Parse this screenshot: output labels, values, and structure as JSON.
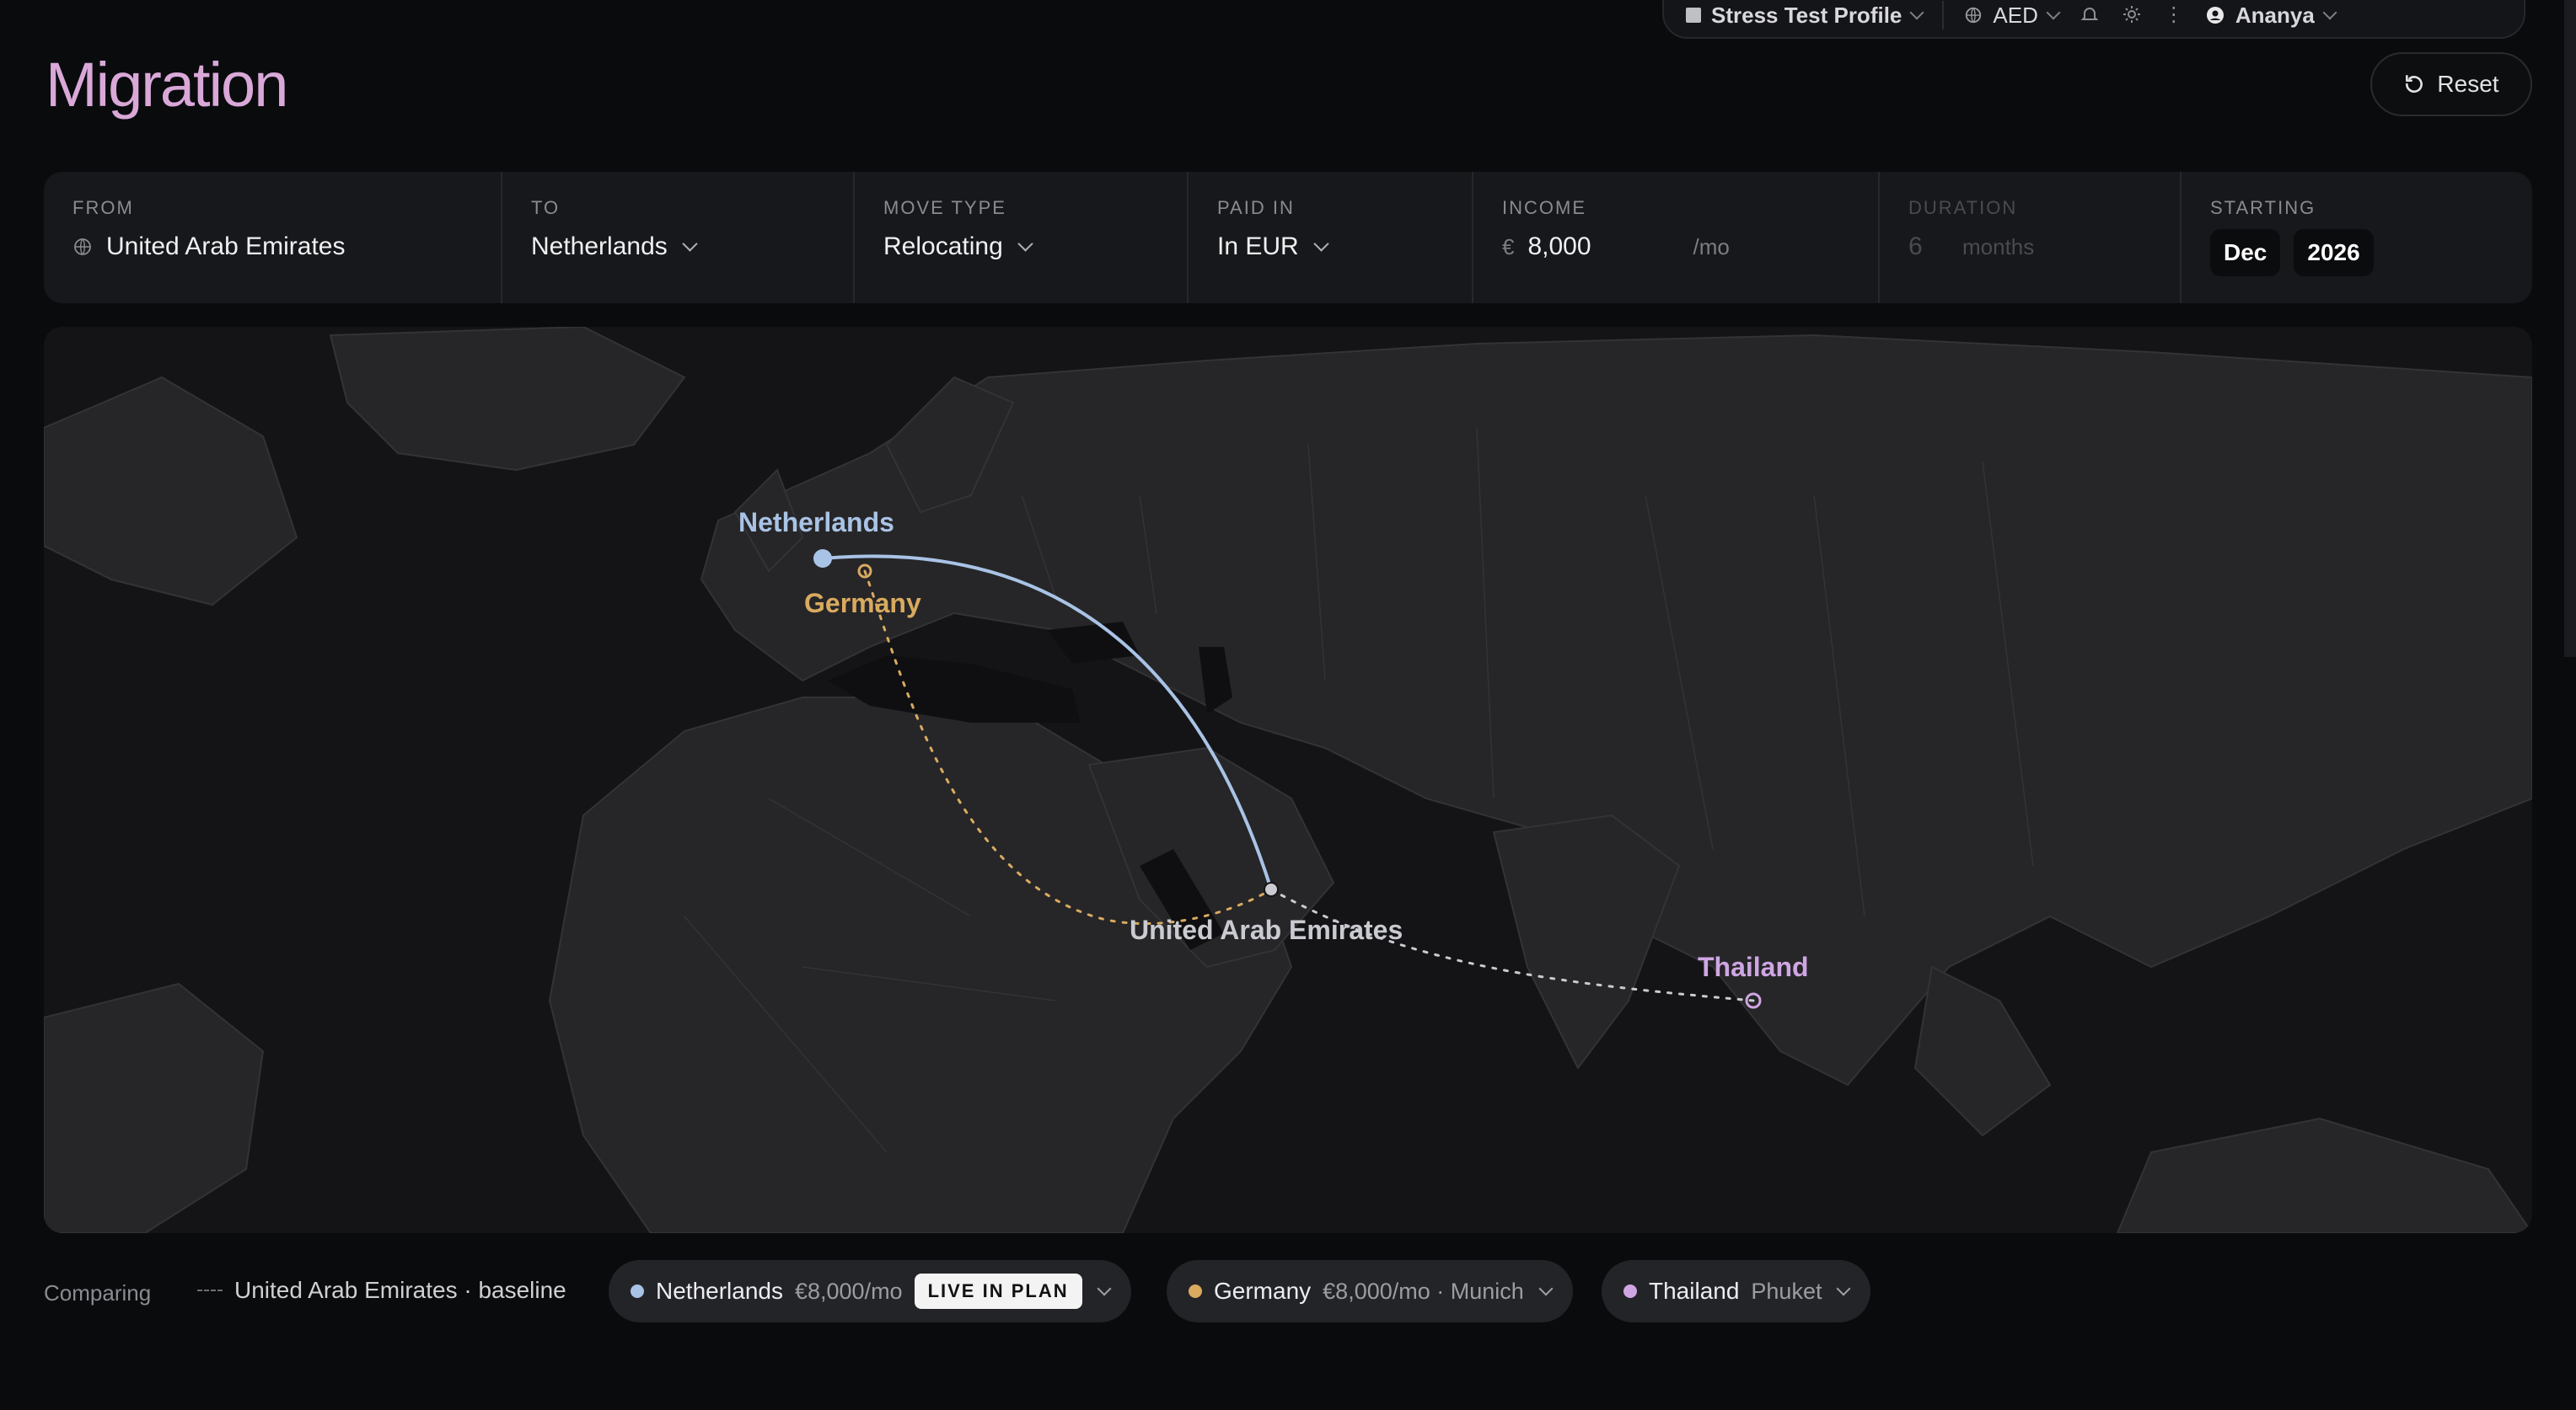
{
  "topbar": {
    "profile": "Stress Test Profile",
    "currency": "AED",
    "user": "Ananya",
    "icons": [
      "bell-icon",
      "sun-icon",
      "more-icon"
    ]
  },
  "header": {
    "title": "Migration",
    "reset_label": "Reset"
  },
  "filters": {
    "from": {
      "label": "FROM",
      "value": "United Arab Emirates"
    },
    "to": {
      "label": "TO",
      "value": "Netherlands"
    },
    "move_type": {
      "label": "MOVE TYPE",
      "value": "Relocating"
    },
    "paid_in": {
      "label": "PAID IN",
      "value": "In EUR"
    },
    "income": {
      "label": "INCOME",
      "currency_symbol": "€",
      "value": "8,000",
      "suffix": "/mo"
    },
    "duration": {
      "label": "DURATION",
      "value": "6",
      "unit": "months"
    },
    "starting": {
      "label": "STARTING",
      "month": "Dec",
      "year": "2026"
    }
  },
  "map": {
    "labels": {
      "netherlands": "Netherlands",
      "germany": "Germany",
      "uae": "United Arab Emirates",
      "thailand": "Thailand"
    },
    "colors": {
      "netherlands": "#a9c3e6",
      "germany": "#d9aa5f",
      "thailand": "#cfa6e3",
      "uae": "#c9cbd0"
    }
  },
  "comparing": {
    "label": "Comparing",
    "baseline": "United Arab Emirates · baseline",
    "chips": [
      {
        "name": "Netherlands",
        "detail": "€8,000/mo",
        "badge": "LIVE IN PLAN",
        "color": "#a9c3e6"
      },
      {
        "name": "Germany",
        "detail": "€8,000/mo · Munich",
        "color": "#d9aa5f"
      },
      {
        "name": "Thailand",
        "detail": "Phuket",
        "color": "#cfa6e3"
      }
    ]
  }
}
